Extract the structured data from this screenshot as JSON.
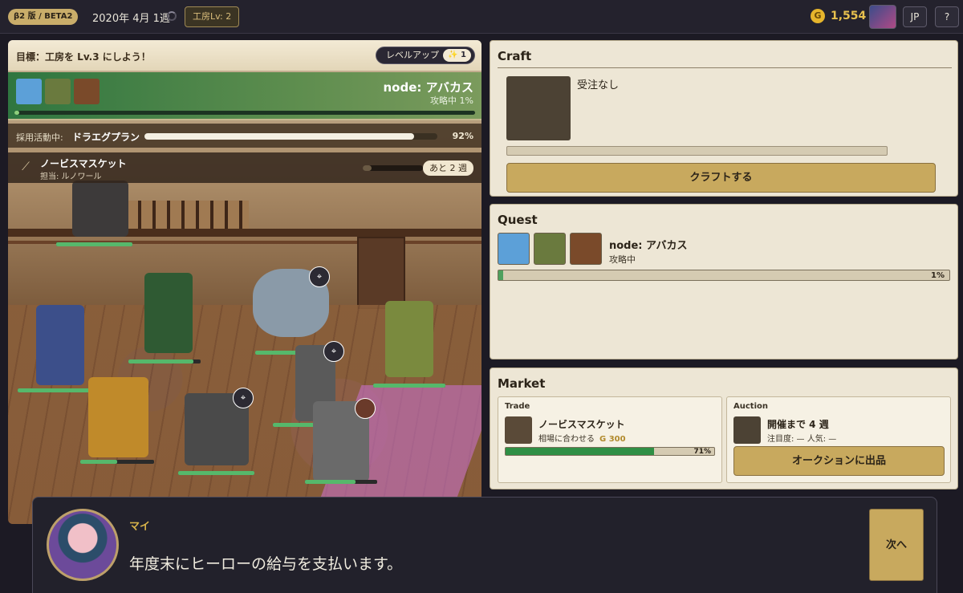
{
  "topbar": {
    "version_badge": "β2 版 / BETA2",
    "date": "2020年 4月 1週",
    "workshop_level": "工房Lv: 2",
    "coin_symbol": "G",
    "gold": "1,554",
    "lang_button": "JP",
    "help_button": "?"
  },
  "scene": {
    "goal": "目標：工房を Lv.3 にしよう！",
    "levelup_label": "レベルアップ",
    "levelup_count": "✨ 1",
    "node": {
      "title": "node: アバカス",
      "status": "攻略中 1%",
      "progress": 0.01
    },
    "adopt": {
      "label": "採用活動中:",
      "name": "ドラエグプラン",
      "percent": "92%",
      "progress": 0.92
    },
    "crafting": {
      "icon": "musket-icon",
      "item": "ノービスマスケット",
      "assignee": "担当: ルノワール",
      "weeks_left": "あと 2 週",
      "progress": 0.15
    },
    "map_badge_icon": "⌖"
  },
  "craft_panel": {
    "title": "Craft",
    "empty_text": "受注なし",
    "button": "クラフトする"
  },
  "quest_panel": {
    "title": "Quest",
    "node_name": "node: アバカス",
    "status": "攻略中",
    "percent": "1%",
    "progress": 0.01
  },
  "market_panel": {
    "title": "Market",
    "trade": {
      "title": "Trade",
      "item": "ノービスマスケット",
      "line": "相場に合わせる",
      "price": "G 300",
      "percent": "71%",
      "progress": 0.71
    },
    "auction": {
      "title": "Auction",
      "schedule": "開催まで 4 週",
      "attention": "注目度: —  人気: —",
      "button": "オークションに出品"
    }
  },
  "dialog": {
    "speaker": "マイ",
    "text": "年度末にヒーローの給与を支払います。",
    "next_button": "次へ"
  },
  "colors": {
    "accent_gold": "#c8a95e",
    "progress_green": "#4ea05e",
    "panel_bg": "#ede6d5",
    "topbar_bg": "#24222d"
  }
}
